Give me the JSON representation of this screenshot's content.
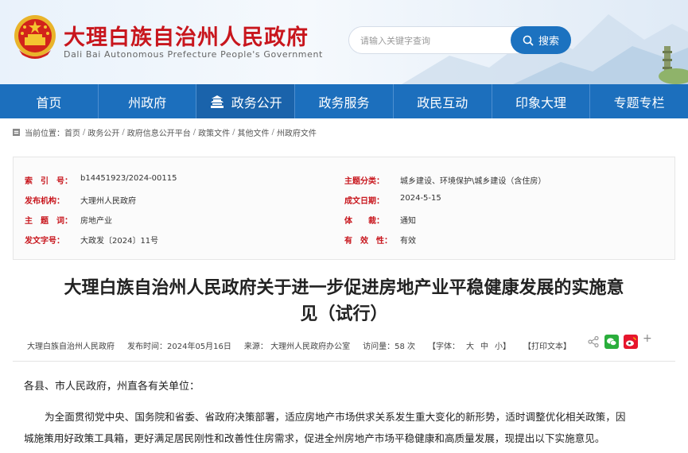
{
  "header": {
    "title": "大理白族自治州人民政府",
    "subtitle": "Dali Bai Autonomous Prefecture People's Government",
    "emblem_icon": "national-emblem-icon",
    "search_placeholder": "请输入关键字查询",
    "search_label": "搜索",
    "brand_color": "#c8161d",
    "accent_color": "#1c6fbd"
  },
  "nav": {
    "items": [
      {
        "label": "首页"
      },
      {
        "label": "州政府"
      },
      {
        "label": "政务公开"
      },
      {
        "label": "政务服务"
      },
      {
        "label": "政民互动"
      },
      {
        "label": "印象大理"
      },
      {
        "label": "专题专栏"
      }
    ],
    "active_index": 2
  },
  "breadcrumb": {
    "prefix": "当前位置：",
    "items": [
      "首页",
      "政务公开",
      "政府信息公开平台",
      "政策文件",
      "其他文件",
      "州政府文件"
    ]
  },
  "meta": {
    "index_label": "索　引　号：",
    "index_value": "b14451923/2024-00115",
    "topic_label": "主题分类：",
    "topic_value": "城乡建设、环境保护\\城乡建设（含住房）",
    "issuer_label": "发布机构：",
    "issuer_value": "大理州人民政府",
    "date_label": "成文日期：",
    "date_value": "2024-5-15",
    "keyword_label": "主　题　词：",
    "keyword_value": "房地产业",
    "genre_label": "体　　裁：",
    "genre_value": "通知",
    "docno_label": "发文字号：",
    "docno_value": "大政发〔2024〕11号",
    "validity_label": "有　效　性：",
    "validity_value": "有效"
  },
  "article": {
    "title_line1": "大理白族自治州人民政府关于进一步促进房地产业平稳健康发展的实施意",
    "title_line2": "见（试行）",
    "author": "大理白族自治州人民政府",
    "publish_time": "发布时间：2024年05月16日",
    "source": "来源：  大理州人民政府办公室",
    "views": "访问量：58 次",
    "font_size_label": "【字体：",
    "font_large": "大",
    "font_medium": "中",
    "font_small": "小】",
    "print_label": "【打印文本】",
    "salutation": "各县、市人民政府，州直各有关单位：",
    "para1_line1": "为全面贯彻党中央、国务院和省委、省政府决策部署，适应房地产市场供求关系发生重大变化的新形势，适时调整优化相关政策，因",
    "para1_line2": "城施策用好政策工具箱，更好满足居民刚性和改善性住房需求，促进全州房地产市场平稳健康和高质量发展，现提出以下实施意见。"
  }
}
